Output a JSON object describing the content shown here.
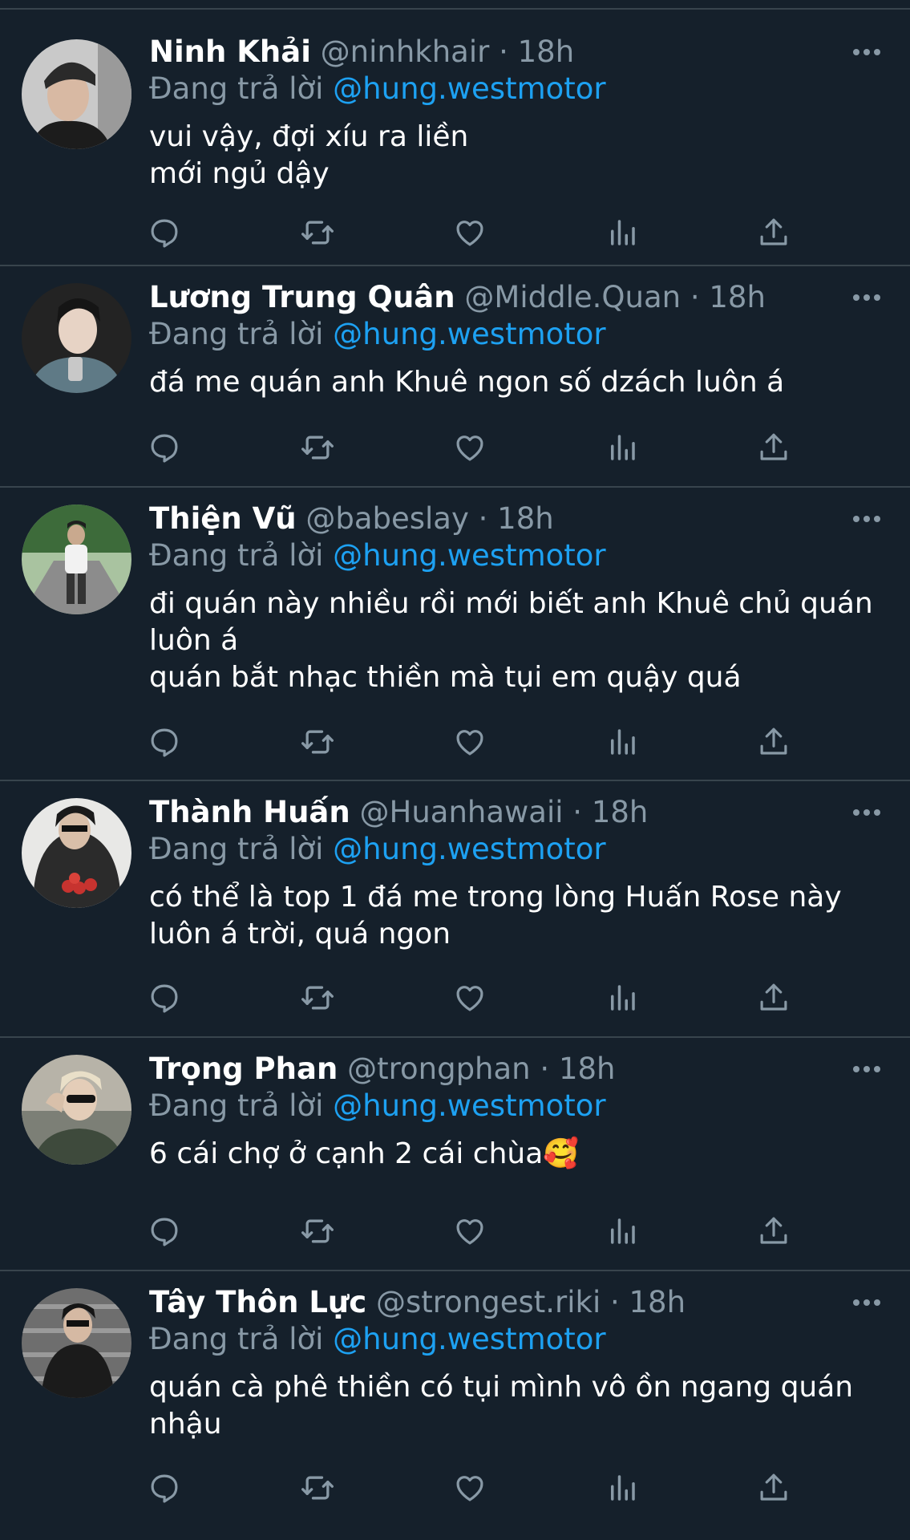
{
  "reply_label": "Đang trả lời",
  "colors": {
    "background": "#15202b",
    "divider": "#38444d",
    "secondary_text": "#8899a6",
    "link": "#1da1f2",
    "icon": "#8899a6"
  },
  "icons": {
    "reply": "speech-bubble-icon",
    "retweet": "retweet-arrows-icon",
    "like": "heart-icon",
    "analytics": "bar-chart-icon",
    "share": "share-upload-icon",
    "more": "three-dots-icon"
  },
  "tweets": [
    {
      "name": "Ninh Khải",
      "handle": "@ninhkhair",
      "time": "18h",
      "replying_to": "@hung.westmotor",
      "text": "vui vậy, đợi xíu ra liền\nmới ngủ dậy"
    },
    {
      "name": "Lương Trung Quân",
      "handle": "@Middle.Quan",
      "time": "18h",
      "replying_to": "@hung.westmotor",
      "text": "đá me quán anh Khuê ngon số dzách luôn á"
    },
    {
      "name": "Thiện Vũ",
      "handle": "@babeslay",
      "time": "18h",
      "replying_to": "@hung.westmotor",
      "text": "đi quán này nhiều rồi mới biết anh Khuê chủ quán luôn á\nquán bắt nhạc thiền mà tụi em quậy quá"
    },
    {
      "name": "Thành Huấn",
      "handle": "@Huanhawaii",
      "time": "18h",
      "replying_to": "@hung.westmotor",
      "text": "có thể là top 1 đá me trong lòng Huấn Rose này luôn á trời, quá ngon"
    },
    {
      "name": "Trọng Phan",
      "handle": "@trongphan",
      "time": "18h",
      "replying_to": "@hung.westmotor",
      "text": "6 cái chợ ở cạnh 2 cái chùa🥰"
    },
    {
      "name": "Tây Thôn Lực",
      "handle": "@strongest.riki",
      "time": "18h",
      "replying_to": "@hung.westmotor",
      "text": "quán cà phê thiền có tụi mình vô ồn ngang quán nhậu"
    }
  ]
}
